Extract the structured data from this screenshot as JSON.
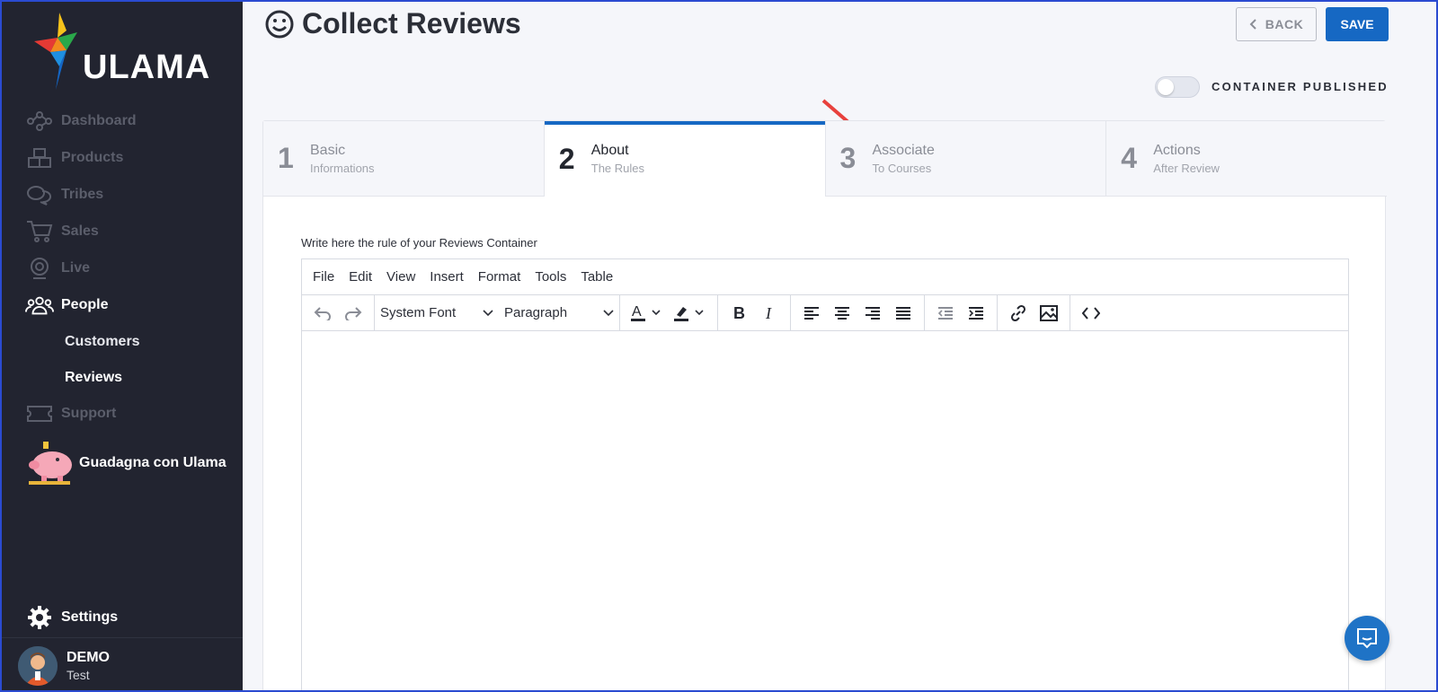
{
  "app": {
    "brand": "ULAMA"
  },
  "sidebar": {
    "items": [
      {
        "label": "Dashboard",
        "icon": "network-icon"
      },
      {
        "label": "Products",
        "icon": "boxes-icon"
      },
      {
        "label": "Tribes",
        "icon": "chat-bubbles-icon"
      },
      {
        "label": "Sales",
        "icon": "cart-icon"
      },
      {
        "label": "Live",
        "icon": "webcam-icon"
      },
      {
        "label": "People",
        "icon": "people-icon"
      },
      {
        "label": "Support",
        "icon": "ticket-icon"
      }
    ],
    "sub_items": [
      {
        "label": "Customers"
      },
      {
        "label": "Reviews"
      }
    ],
    "promo_label": "Guadagna con Ulama",
    "settings_label": "Settings",
    "user": {
      "name": "DEMO",
      "sub": "Test"
    }
  },
  "header": {
    "title": "Collect Reviews",
    "back_label": "BACK",
    "save_label": "SAVE",
    "toggle_label": "CONTAINER PUBLISHED",
    "toggle_on": false
  },
  "steps": [
    {
      "num": "1",
      "title": "Basic",
      "sub": "Informations",
      "active": false
    },
    {
      "num": "2",
      "title": "About",
      "sub": "The Rules",
      "active": true
    },
    {
      "num": "3",
      "title": "Associate",
      "sub": "To Courses",
      "active": false
    },
    {
      "num": "4",
      "title": "Actions",
      "sub": "After Review",
      "active": false
    }
  ],
  "editor": {
    "label": "Write here the rule of your Reviews Container",
    "menu": [
      "File",
      "Edit",
      "View",
      "Insert",
      "Format",
      "Tools",
      "Table"
    ],
    "font_select": "System Font",
    "block_select": "Paragraph"
  },
  "colors": {
    "sidebar_bg": "#222430",
    "accent": "#1668c3",
    "annotation_arrow": "#e8413d"
  }
}
